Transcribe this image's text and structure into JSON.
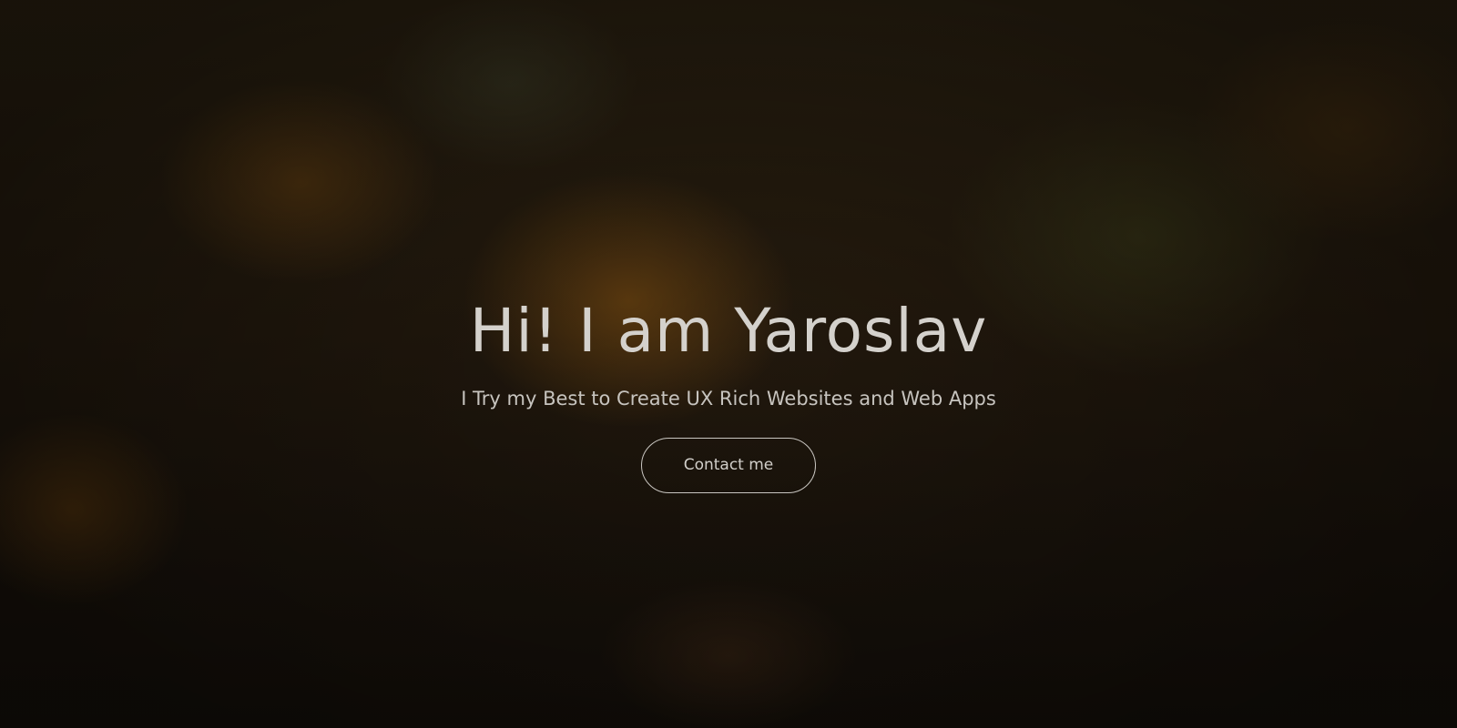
{
  "hero": {
    "headline": "Hi! I am Yaroslav",
    "subline": "I Try my Best to Create UX Rich Websites and Web Apps",
    "cta_label": "Contact me"
  },
  "colors": {
    "text": "#d4d1cc",
    "button_border": "#c9c6c1",
    "background_dark": "#1a130b"
  }
}
